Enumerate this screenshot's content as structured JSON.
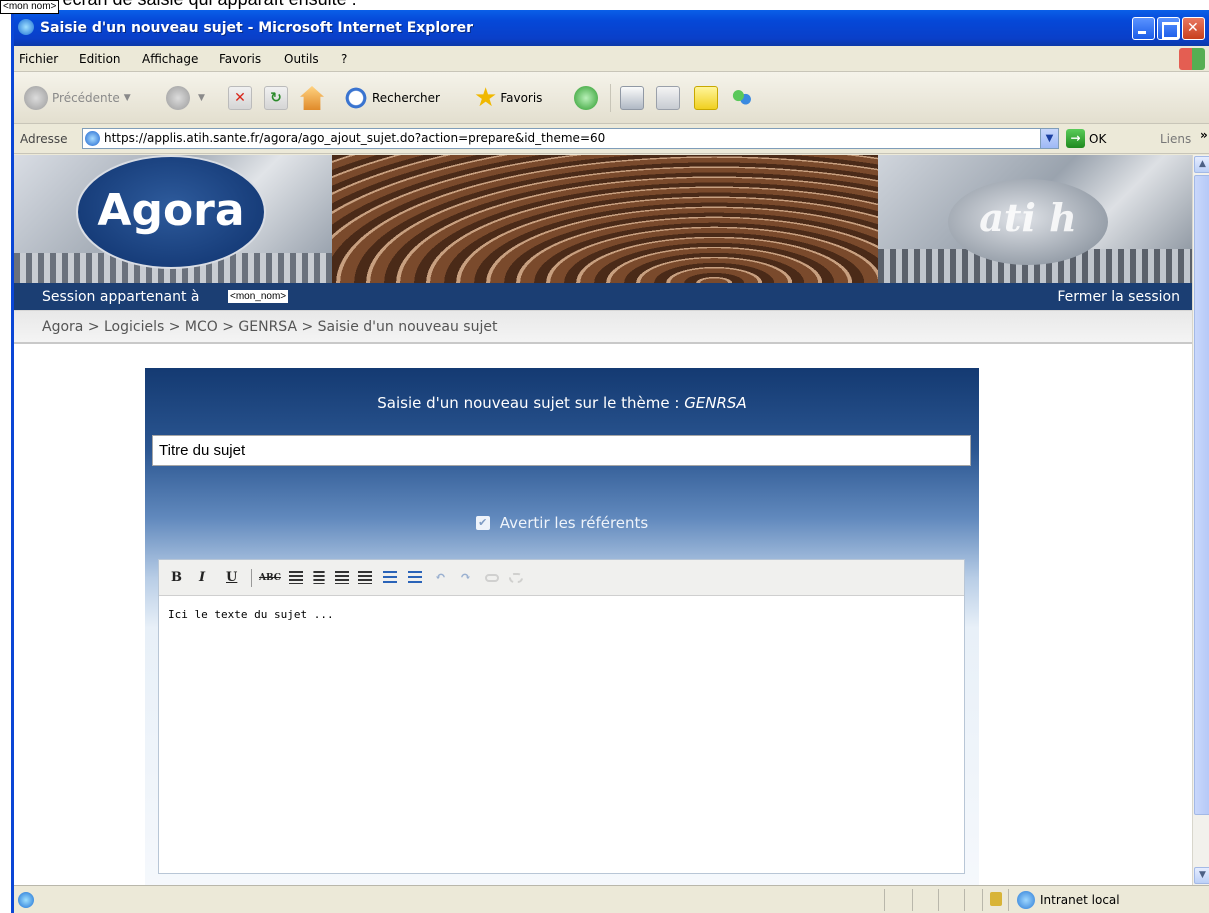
{
  "caption": {
    "text": "Voici l'écran de saisie qui apparaît ensuite :",
    "tag": "<mon nom>"
  },
  "window": {
    "title": "Saisie d'un nouveau sujet - Microsoft Internet Explorer"
  },
  "menu": [
    "Fichier",
    "Edition",
    "Affichage",
    "Favoris",
    "Outils",
    "?"
  ],
  "toolbar": {
    "back_label": "Précédente",
    "search_label": "Rechercher",
    "favorites_label": "Favoris"
  },
  "address": {
    "label": "Adresse",
    "url": "https://applis.atih.sante.fr/agora/ago_ajout_sujet.do?action=prepare&id_theme=60",
    "go_label": "OK",
    "links_label": "Liens",
    "links_more": "»"
  },
  "banner": {
    "logo_text": "Agora",
    "partner_text": "ati h"
  },
  "session": {
    "prefix": "Session appartenant à",
    "user": "<mon_nom>",
    "logout": "Fermer la session"
  },
  "breadcrumb": "Agora > Logiciels > MCO > GENRSA > Saisie d'un nouveau sujet",
  "form": {
    "title_prefix": "Saisie d'un nouveau sujet sur le thème :",
    "theme": "GENRSA",
    "subject_value": "Titre du sujet",
    "notify_label": "Avertir les référents",
    "notify_checked": true,
    "editor_text": "Ici le texte du sujet ..."
  },
  "status": {
    "zone": "Intranet local"
  },
  "colors": {
    "xp_title": "#0a5fe8",
    "session_bar": "#1b3e73",
    "form_header": "#143a72"
  }
}
